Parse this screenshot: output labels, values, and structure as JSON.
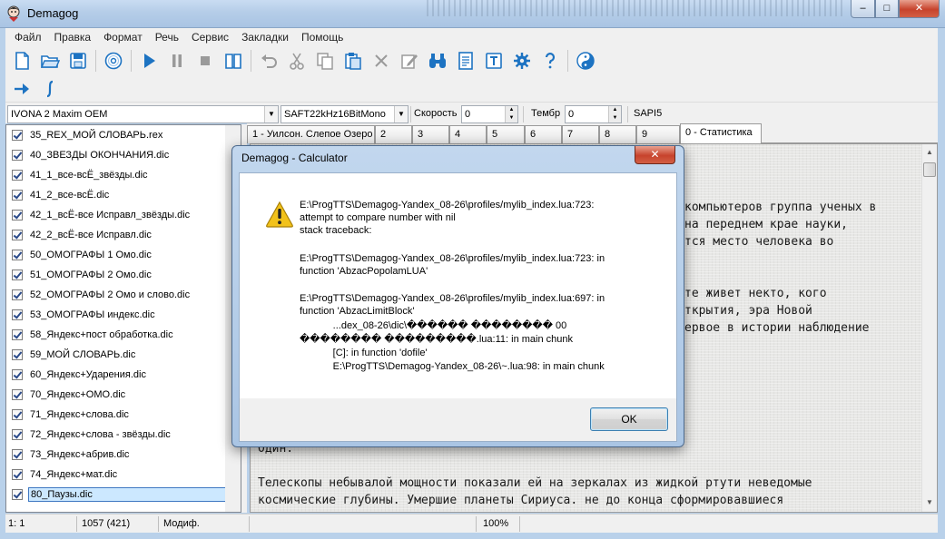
{
  "window": {
    "title": "Demagog",
    "minimize": "–",
    "maximize": "□",
    "close": "✕"
  },
  "menu": [
    "Файл",
    "Правка",
    "Формат",
    "Речь",
    "Сервис",
    "Закладки",
    "Помощь"
  ],
  "toolbar_icons": [
    "new-file-icon",
    "open-folder-icon",
    "save-icon",
    "cd-icon",
    "play-icon",
    "pause-icon",
    "stop-icon",
    "book-icon",
    "undo-icon",
    "cut-icon",
    "copy-icon",
    "paste-icon",
    "delete-icon",
    "edit-icon",
    "find-icon",
    "document-icon",
    "text-icon",
    "settings-icon",
    "help-icon",
    "yin-yang-icon"
  ],
  "toolbar2_icons": [
    "arrow-right-icon",
    "integral-icon"
  ],
  "voicebar": {
    "voice": "IVONA 2 Maxim OEM",
    "format": "SAFT22kHz16BitMono",
    "speed_label": "Скорость",
    "speed_value": "0",
    "timbre_label": "Тембр",
    "timbre_value": "0",
    "engine": "SAPI5"
  },
  "files": [
    "35_REX_МОЙ СЛОВАРЬ.rex",
    "40_ЗВЕЗДЫ ОКОНЧАНИЯ.dic",
    "41_1_все-всЁ_звёзды.dic",
    "41_2_все-всЁ.dic",
    "42_1_всЁ-все Исправл_звёзды.dic",
    "42_2_всЁ-все Исправл.dic",
    "50_ОМОГРАФЫ 1 Омо.dic",
    "51_ОМОГРАФЫ 2 Омо.dic",
    "52_ОМОГРАФЫ 2 Омо и слово.dic",
    "53_ОМОГРАФЫ индекс.dic",
    "58_Яндекс+пост обработка.dic",
    "59_МОЙ СЛОВАРЬ.dic",
    "60_Яндекс+Ударения.dic",
    "70_Яндекс+ОМО.dic",
    "71_Яндекс+слова.dic",
    "72_Яндекс+слова - звёзды.dic",
    "73_Яндекс+абрив.dic",
    "74_Яндекс+мат.dic",
    "80_Паузы.dic"
  ],
  "tabs": [
    "1 - Уилсон. Слепое Озеро",
    "2",
    "3",
    "4",
    "5",
    "6",
    "7",
    "8",
    "9",
    "0 - Статистика"
  ],
  "text_lines": [
    "компьютеров группа ученых в",
    "на переднем крае науки,",
    "тся место человека во",
    "те живет некто, кого",
    "ткрытия, эра Новой",
    "ервое в истории наблюдение",
    "Один.",
    "Телескопы небывалой мощности показали ей на зеркалах из жидкой ртути неведомые",
    "космические глубины. Умершие планеты Сириуса. не до конца сформировавшиеся"
  ],
  "status": {
    "position": "1: 1",
    "count": "1057 (421)",
    "state": "Модиф.",
    "zoom": "100%"
  },
  "dialog": {
    "title": "Demagog - Calculator",
    "close": "✕",
    "message_lines": [
      "E:\\ProgTTS\\Demagog-Yandex_08-26\\profiles/mylib_index.lua:723:",
      "attempt to compare number with nil",
      "stack traceback:",
      "",
      "E:\\ProgTTS\\Demagog-Yandex_08-26\\profiles/mylib_index.lua:723: in",
      "function 'AbzacPopolamLUA'",
      "",
      "E:\\ProgTTS\\Demagog-Yandex_08-26\\profiles/mylib_index.lua:697: in",
      "function 'AbzacLimitBlock'",
      "            ...dex_08-26\\dic\\������ �������� 00",
      "�������� ���������.lua:11: in main chunk",
      "            [C]: in function 'dofile'",
      "            E:\\ProgTTS\\Demagog-Yandex_08-26\\~.lua:98: in main chunk"
    ],
    "ok_label": "OK"
  },
  "colors": {
    "accent": "#1d73c2",
    "selection": "#cce8ff",
    "frame": "#b9d1ea"
  }
}
